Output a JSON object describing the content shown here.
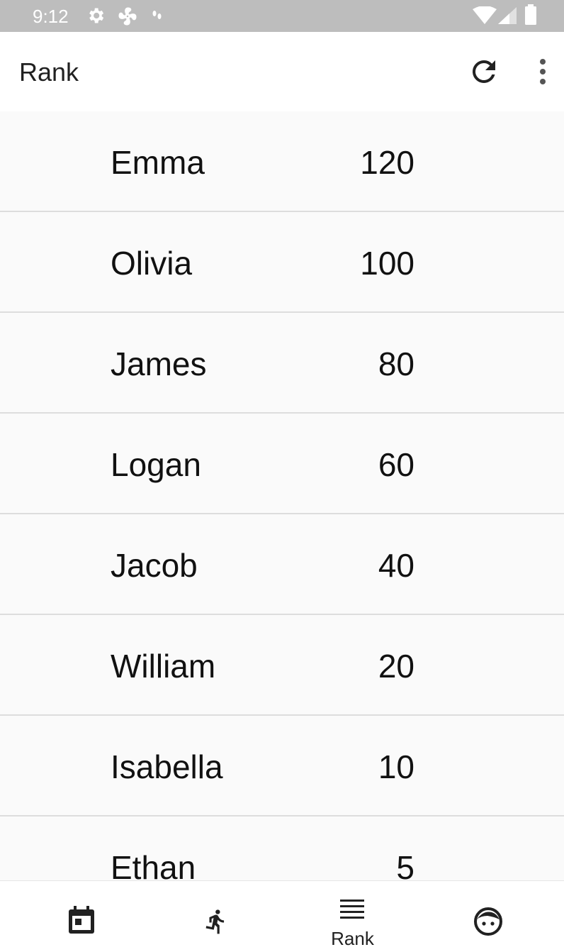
{
  "status_bar": {
    "time": "9:12",
    "icons": [
      "gear-icon",
      "fan-icon",
      "footprints-icon",
      "wifi-icon",
      "cell-signal-icon",
      "battery-icon"
    ]
  },
  "app_bar": {
    "title": "Rank",
    "actions": [
      "refresh-icon",
      "more-vert-icon"
    ]
  },
  "rank_list": [
    {
      "name": "Emma",
      "score": "120"
    },
    {
      "name": "Olivia",
      "score": "100"
    },
    {
      "name": "James",
      "score": "80"
    },
    {
      "name": "Logan",
      "score": "60"
    },
    {
      "name": "Jacob",
      "score": "40"
    },
    {
      "name": "William",
      "score": "20"
    },
    {
      "name": "Isabella",
      "score": "10"
    },
    {
      "name": "Ethan",
      "score": "5"
    }
  ],
  "bottom_nav": {
    "items": [
      {
        "icon": "calendar-icon",
        "label": ""
      },
      {
        "icon": "running-icon",
        "label": ""
      },
      {
        "icon": "list-icon",
        "label": "Rank"
      },
      {
        "icon": "face-icon",
        "label": ""
      }
    ],
    "active_index": 2
  },
  "colors": {
    "status_bar": "#bdbdbd",
    "app_bar": "#ffffff",
    "list_background": "#fafafa",
    "divider": "#dddddd",
    "text": "#111111"
  }
}
